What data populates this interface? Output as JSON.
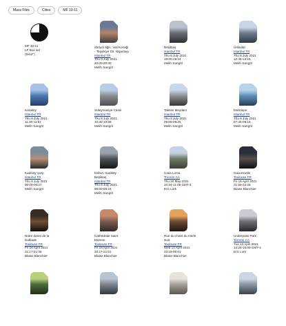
{
  "tabs": [
    "Mass Files",
    "Cities",
    "MF 10-11"
  ],
  "cards": [
    {
      "kind": "pie",
      "lines": [
        "MF 10-11",
        "LP Box set",
        "(5x12\")"
      ],
      "loc": "",
      "date": "",
      "author": "",
      "colors": []
    },
    {
      "kind": "photo",
      "lines": [
        "dörtyol ağzı, Vali Konağı",
        "- Teşvikiye Str, Nişantaşı"
      ],
      "loc": "Istanbul TR",
      "date": "Thu 8 July 2021",
      "time": "20:00-20:30",
      "author": "Melih Sarıgöl",
      "colors": [
        "#6b7a94",
        "#b48468",
        "#3a3f3f"
      ]
    },
    {
      "kind": "photo",
      "lines": [
        "Beşiktaş"
      ],
      "loc": "Istanbul TR",
      "date": "Thu 8 July 2021",
      "time": "19:00-19:24",
      "author": "Melih Sarıgöl",
      "colors": [
        "#b9c3cf",
        "#6a6e74",
        "#2d2f32"
      ]
    },
    {
      "kind": "photo",
      "lines": [
        "Üsküdar"
      ],
      "loc": "Istanbul TR",
      "date": "Thu 8 July 2021",
      "time": "12:45-13:15",
      "author": "Melih Sarıgöl",
      "colors": [
        "#c6d6e6",
        "#6f7c8e",
        "#2f3a44"
      ]
    },
    {
      "kind": "photo",
      "lines": [
        "Karaköy"
      ],
      "loc": "Istanbul TR",
      "date": "Thu 8 July 2021",
      "time": "11:30-11:57",
      "author": "Melih Sarıgöl",
      "colors": [
        "#a6c2e6",
        "#4d79b0",
        "#233f63"
      ]
    },
    {
      "kind": "photo",
      "lines": [
        "Süleymaniye Camii"
      ],
      "loc": "Istanbul TR",
      "date": "Thu 8 July 2021",
      "time": "10:30-10:58",
      "author": "Melih Sarıgöl",
      "colors": [
        "#b7cde6",
        "#8a8d90",
        "#4d4f52"
      ]
    },
    {
      "kind": "photo",
      "lines": [
        "Taksim Meydanı"
      ],
      "loc": "Istanbul TR",
      "date": "Thu 8 July 2021",
      "time": "09:00-09:25",
      "author": "Melih Sarıgöl",
      "colors": [
        "#c9d8e8",
        "#8d8f92",
        "#343536"
      ]
    },
    {
      "kind": "photo",
      "lines": [
        "Esentepe"
      ],
      "loc": "Istanbul TR",
      "date": "Thu 8 July 2021",
      "time": "07:45-08:16",
      "author": "Melih Sarıgöl",
      "colors": [
        "#b6d3ec",
        "#5f8fba",
        "#2b3d52"
      ]
    },
    {
      "kind": "photo",
      "lines": [
        "Kadıköy çarşı"
      ],
      "loc": "Istanbul TR",
      "date": "Thu 8 July 2021",
      "time": "00:00-00:27",
      "author": "Melih Sarıgöl",
      "colors": [
        "#7d8c9c",
        "#b98c77",
        "#2a2d31"
      ]
    },
    {
      "kind": "photo",
      "lines": [
        "feribot, Kadıköy -",
        "Beşiktaş"
      ],
      "loc": "Istanbul TR",
      "date": "Thu 8 July 2021",
      "time": "00:00-00:24",
      "author": "Melih Sarıgöl",
      "colors": [
        "#9aa3ad",
        "#4e5358",
        "#141618"
      ]
    },
    {
      "kind": "photo",
      "lines": [
        "Casa Loma"
      ],
      "loc": "Toronto CA",
      "date": "Thu 20 May 2021",
      "time": "10:34-11:09 GMT-4",
      "author": "Eric Lork",
      "colors": [
        "#c6d3e2",
        "#6f7b69",
        "#3a4035"
      ]
    },
    {
      "kind": "photo",
      "lines": [
        "Gaixonnelle"
      ],
      "loc": "Toulouse FR",
      "date": "Fri 16 April 2021",
      "time": "21:56-22:25",
      "author": "Blaise Blanchier",
      "colors": [
        "#2a2d3a",
        "#56504a",
        "#0f1014"
      ]
    },
    {
      "kind": "photo",
      "lines": [
        "Notre dame de la",
        "Dalbade"
      ],
      "loc": "Toulouse FR",
      "date": "Fri 16 April 2021",
      "time": "21:17-21:48",
      "author": "Blaise Blanchier",
      "colors": [
        "#3a2c22",
        "#6e4f32",
        "#140f0b"
      ]
    },
    {
      "kind": "photo",
      "lines": [
        "Cathédrale Saint",
        "Etienne"
      ],
      "loc": "Toulouse FR",
      "date": "Fri 16 April 2021",
      "time": "20:27-21:01",
      "author": "Blaise Blanchier",
      "colors": [
        "#c68a6b",
        "#7a5a4f",
        "#2f2a2c"
      ]
    },
    {
      "kind": "photo",
      "lines": [
        "Rue du chant du merle",
        "Nuit"
      ],
      "loc": "Toulouse FR",
      "date": "Wed 14 April 2021",
      "time": "23:19-00:01",
      "author": "Blaise Blanchier",
      "colors": [
        "#e3a35c",
        "#6b4a33",
        "#1e1712"
      ]
    },
    {
      "kind": "photo",
      "lines": [
        "Underpass Park"
      ],
      "loc": "Toronto CA",
      "date": "Tue 13 April 2021",
      "time": "14:26-15:00 GMT-4",
      "author": "Eric Lork",
      "colors": [
        "#c9ccd2",
        "#6c6f74",
        "#28292c"
      ]
    },
    {
      "kind": "photo",
      "lines": [],
      "loc": "",
      "date": "",
      "time": "",
      "author": "",
      "colors": [
        "#b8d07a",
        "#4e6b3c",
        "#223018"
      ]
    },
    {
      "kind": "photo",
      "lines": [],
      "loc": "",
      "date": "",
      "time": "",
      "author": "",
      "colors": [
        "#b9c4d2",
        "#7d8590",
        "#33383e"
      ]
    },
    {
      "kind": "photo",
      "lines": [],
      "loc": "",
      "date": "",
      "time": "",
      "author": "",
      "colors": [
        "#e7e3dc",
        "#a5a09a",
        "#5a5651"
      ]
    },
    {
      "kind": "photo",
      "lines": [],
      "loc": "",
      "date": "",
      "time": "",
      "author": "",
      "colors": [
        "#c9d6e3",
        "#8b97a3",
        "#3a4149"
      ]
    }
  ]
}
